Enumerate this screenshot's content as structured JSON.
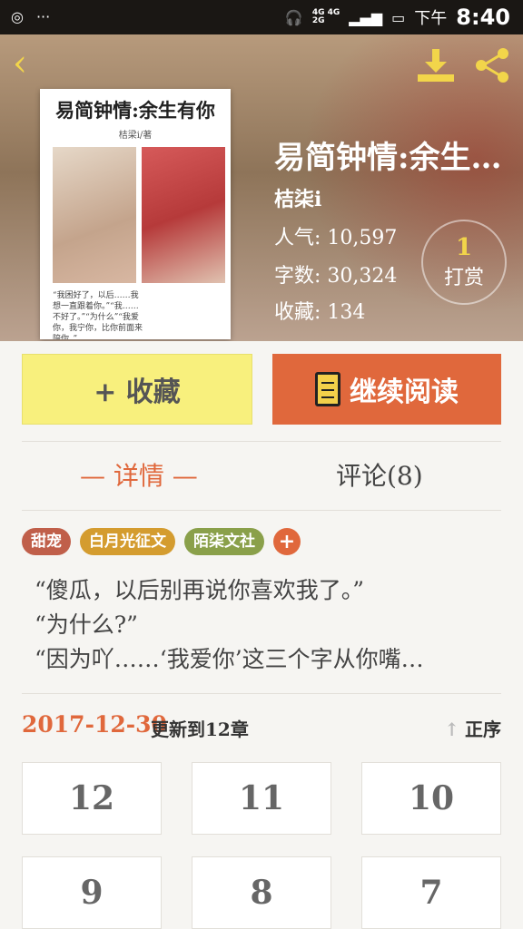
{
  "status_bar": {
    "time_prefix": "下午",
    "time": "8:40",
    "network": "4G 4G",
    "network2": "2G"
  },
  "book": {
    "title": "易简钟情:余生…",
    "cover_title": "易简钟情:余生有你",
    "cover_author": "桔梁i/著",
    "cover_text": "“我困好了，以后……我想一直跟着你。”“我……不好了。”“为什么”“我爱你，我宁你，比你前面来陪你。”",
    "author": "桔柒i",
    "popularity_label": "人气:",
    "popularity": "10,597",
    "words_label": "字数:",
    "words": "30,324",
    "favorites_label": "收藏:",
    "favorites": "134"
  },
  "tip": {
    "count": "1",
    "label": "打赏"
  },
  "actions": {
    "collect": "+ 收藏",
    "read": "继续阅读"
  },
  "tabs": {
    "detail": "— 详情 —",
    "comments": "评论(8)"
  },
  "tags": [
    "甜宠",
    "白月光征文",
    "陌柒文社"
  ],
  "tag_add": "+",
  "synopsis": [
    "“傻瓜，以后别再说你喜欢我了。”",
    "“为什么?”",
    "“因为吖……‘我爱你’这三个字从你嘴…"
  ],
  "update": {
    "date": "2017-12-30",
    "text": "更新到12章",
    "sort": "正序"
  },
  "chapters": [
    "12",
    "11",
    "10",
    "9",
    "8",
    "7"
  ]
}
